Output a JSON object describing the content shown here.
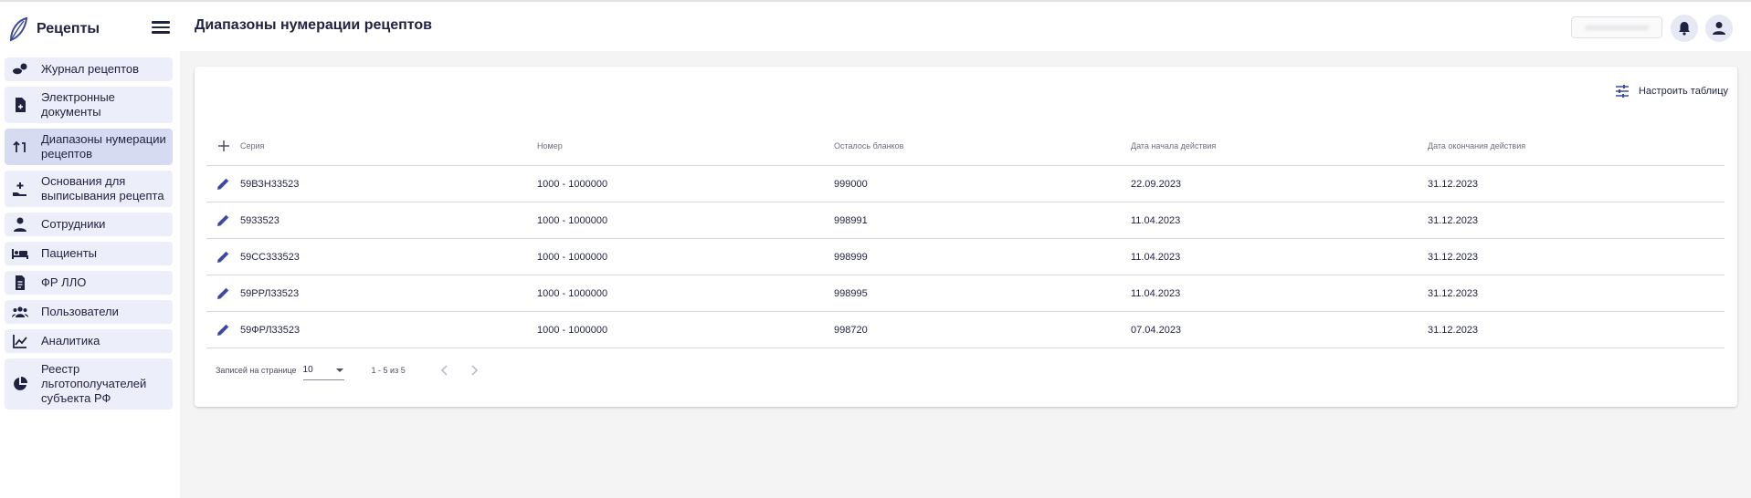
{
  "app": {
    "title": "Рецепты",
    "logo_icon": "leaf-logo-icon",
    "menu_icon": "hamburger-icon",
    "accent": "#3c4a9e",
    "nav_bg": "#eceef9",
    "nav_active_bg": "#d7dbf1"
  },
  "sidebar": {
    "items": [
      {
        "label": "Журнал рецептов",
        "icon": "pills-icon",
        "active": false
      },
      {
        "label": "Электронные документы",
        "icon": "document-icon",
        "active": false
      },
      {
        "label": "Диапазоны нумерации рецептов",
        "icon": "sort-numbers-icon",
        "active": true
      },
      {
        "label": "Основания для выписывания рецепта",
        "icon": "hand-plus-icon",
        "active": false
      },
      {
        "label": "Сотрудники",
        "icon": "staff-icon",
        "active": false
      },
      {
        "label": "Пациенты",
        "icon": "bed-icon",
        "active": false
      },
      {
        "label": "ФР ЛЛО",
        "icon": "clipboard-icon",
        "active": false
      },
      {
        "label": "Пользователи",
        "icon": "group-icon",
        "active": false
      },
      {
        "label": "Аналитика",
        "icon": "line-chart-icon",
        "active": false
      },
      {
        "label": "Реестр льготополучателей субъекта РФ",
        "icon": "pie-chart-icon",
        "active": false
      }
    ]
  },
  "header": {
    "title": "Диапазоны нумерации рецептов",
    "bell_icon": "bell-icon",
    "user_icon": "user-icon"
  },
  "toolbar": {
    "configure_label": "Настроить таблицу",
    "configure_icon": "tune-icon"
  },
  "table": {
    "add_icon": "plus-icon",
    "edit_icon": "pencil-icon",
    "columns": [
      "Серия",
      "Номер",
      "Осталось бланков",
      "Дата начала действия",
      "Дата окончания действия"
    ],
    "rows": [
      [
        "59ВЗН33523",
        "1000 - 1000000",
        "999000",
        "22.09.2023",
        "31.12.2023"
      ],
      [
        "5933523",
        "1000 - 1000000",
        "998991",
        "11.04.2023",
        "31.12.2023"
      ],
      [
        "59СС333523",
        "1000 - 1000000",
        "998999",
        "11.04.2023",
        "31.12.2023"
      ],
      [
        "59РРЛ33523",
        "1000 - 1000000",
        "998995",
        "11.04.2023",
        "31.12.2023"
      ],
      [
        "59ФРЛ33523",
        "1000 - 1000000",
        "998720",
        "07.04.2023",
        "31.12.2023"
      ]
    ]
  },
  "pagination": {
    "per_page_label": "Записей на странице",
    "per_page_value": "10",
    "range_text": "1 - 5 из 5"
  }
}
